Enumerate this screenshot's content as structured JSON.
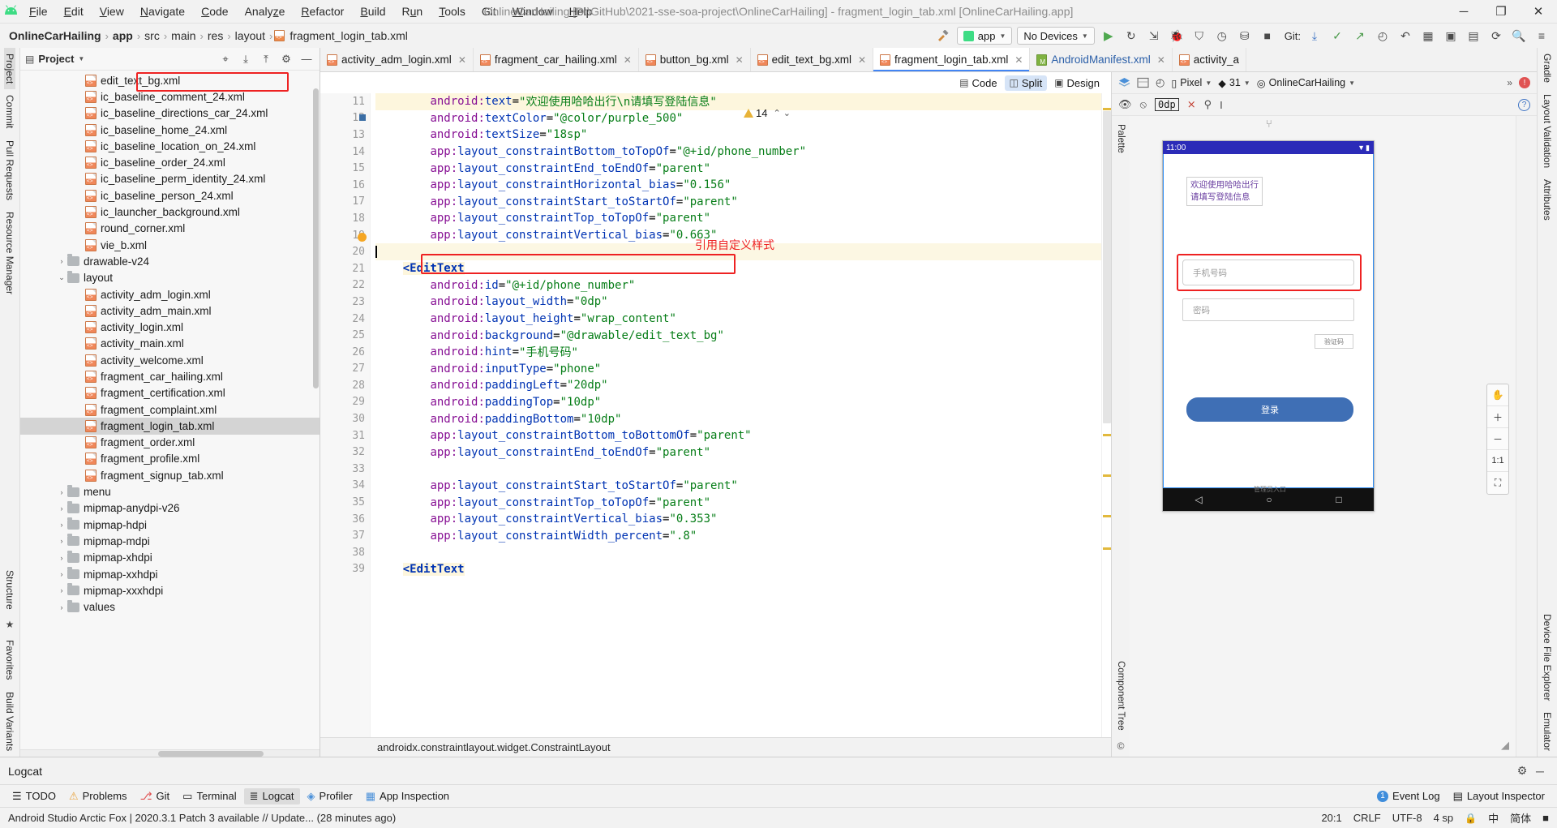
{
  "window": {
    "title": "OnlineCarHailing [D:\\GitHub\\2021-sse-soa-project\\OnlineCarHailing] - fragment_login_tab.xml [OnlineCarHailing.app]",
    "minimize": "─",
    "maximize": "❐",
    "close": "✕"
  },
  "menu": [
    {
      "label": "File"
    },
    {
      "label": "Edit"
    },
    {
      "label": "View"
    },
    {
      "label": "Navigate"
    },
    {
      "label": "Code"
    },
    {
      "label": "Analyze"
    },
    {
      "label": "Refactor"
    },
    {
      "label": "Build"
    },
    {
      "label": "Run"
    },
    {
      "label": "Tools"
    },
    {
      "label": "Git"
    },
    {
      "label": "Window"
    },
    {
      "label": "Help"
    }
  ],
  "breadcrumb": {
    "items": [
      "OnlineCarHailing",
      "app",
      "src",
      "main",
      "res",
      "layout",
      "fragment_login_tab.xml"
    ],
    "separator": "›"
  },
  "toolbar": {
    "hammer_icon": "hammer-icon",
    "app_config": "app",
    "device": "No Devices",
    "run_icon": "run-icon",
    "rerun_icon": "rerun-icon",
    "git_label": "Git:",
    "search_icon": "search-icon"
  },
  "left_rail": [
    {
      "label": "Project",
      "selected": true
    },
    {
      "label": "Commit",
      "selected": false
    },
    {
      "label": "Pull Requests",
      "selected": false
    },
    {
      "label": "Resource Manager",
      "selected": false
    },
    {
      "label": "Structure",
      "selected": false
    },
    {
      "label": "Favorites",
      "selected": false
    },
    {
      "label": "Build Variants",
      "selected": false
    }
  ],
  "right_rail": [
    {
      "label": "Gradle"
    },
    {
      "label": "Layout Validation"
    },
    {
      "label": "Attributes"
    },
    {
      "label": "Device File Explorer"
    },
    {
      "label": "Emulator"
    }
  ],
  "project_panel": {
    "title": "Project",
    "caret": "▾",
    "icons": [
      "target-icon",
      "collapse-icon",
      "expand-icon",
      "gear-icon",
      "minimize-icon"
    ],
    "tree": [
      {
        "indent": 3,
        "label": "edit_text_bg.xml",
        "type": "xml",
        "highlighted": true
      },
      {
        "indent": 3,
        "label": "ic_baseline_comment_24.xml",
        "type": "xml"
      },
      {
        "indent": 3,
        "label": "ic_baseline_directions_car_24.xml",
        "type": "xml"
      },
      {
        "indent": 3,
        "label": "ic_baseline_home_24.xml",
        "type": "xml"
      },
      {
        "indent": 3,
        "label": "ic_baseline_location_on_24.xml",
        "type": "xml"
      },
      {
        "indent": 3,
        "label": "ic_baseline_order_24.xml",
        "type": "xml"
      },
      {
        "indent": 3,
        "label": "ic_baseline_perm_identity_24.xml",
        "type": "xml"
      },
      {
        "indent": 3,
        "label": "ic_baseline_person_24.xml",
        "type": "xml"
      },
      {
        "indent": 3,
        "label": "ic_launcher_background.xml",
        "type": "xml"
      },
      {
        "indent": 3,
        "label": "round_corner.xml",
        "type": "xml"
      },
      {
        "indent": 3,
        "label": "vie_b.xml",
        "type": "xml"
      },
      {
        "indent": 2,
        "label": "drawable-v24",
        "type": "folder",
        "arrow": "›"
      },
      {
        "indent": 2,
        "label": "layout",
        "type": "folder",
        "arrow": "⌄"
      },
      {
        "indent": 3,
        "label": "activity_adm_login.xml",
        "type": "xml"
      },
      {
        "indent": 3,
        "label": "activity_adm_main.xml",
        "type": "xml"
      },
      {
        "indent": 3,
        "label": "activity_login.xml",
        "type": "xml"
      },
      {
        "indent": 3,
        "label": "activity_main.xml",
        "type": "xml"
      },
      {
        "indent": 3,
        "label": "activity_welcome.xml",
        "type": "xml"
      },
      {
        "indent": 3,
        "label": "fragment_car_hailing.xml",
        "type": "xml"
      },
      {
        "indent": 3,
        "label": "fragment_certification.xml",
        "type": "xml"
      },
      {
        "indent": 3,
        "label": "fragment_complaint.xml",
        "type": "xml"
      },
      {
        "indent": 3,
        "label": "fragment_login_tab.xml",
        "type": "xml",
        "selected": true
      },
      {
        "indent": 3,
        "label": "fragment_order.xml",
        "type": "xml"
      },
      {
        "indent": 3,
        "label": "fragment_profile.xml",
        "type": "xml"
      },
      {
        "indent": 3,
        "label": "fragment_signup_tab.xml",
        "type": "xml"
      },
      {
        "indent": 2,
        "label": "menu",
        "type": "folder",
        "arrow": "›"
      },
      {
        "indent": 2,
        "label": "mipmap-anydpi-v26",
        "type": "folder",
        "arrow": "›"
      },
      {
        "indent": 2,
        "label": "mipmap-hdpi",
        "type": "folder",
        "arrow": "›"
      },
      {
        "indent": 2,
        "label": "mipmap-mdpi",
        "type": "folder",
        "arrow": "›"
      },
      {
        "indent": 2,
        "label": "mipmap-xhdpi",
        "type": "folder",
        "arrow": "›"
      },
      {
        "indent": 2,
        "label": "mipmap-xxhdpi",
        "type": "folder",
        "arrow": "›"
      },
      {
        "indent": 2,
        "label": "mipmap-xxxhdpi",
        "type": "folder",
        "arrow": "›"
      },
      {
        "indent": 2,
        "label": "values",
        "type": "folder",
        "arrow": "›"
      }
    ]
  },
  "editor_tabs": [
    {
      "label": "activity_adm_login.xml",
      "icon": "xml",
      "active": false
    },
    {
      "label": "fragment_car_hailing.xml",
      "icon": "xml",
      "active": false
    },
    {
      "label": "button_bg.xml",
      "icon": "xml",
      "active": false
    },
    {
      "label": "edit_text_bg.xml",
      "icon": "xml",
      "active": false
    },
    {
      "label": "fragment_login_tab.xml",
      "icon": "xml",
      "active": true
    },
    {
      "label": "AndroidManifest.xml",
      "icon": "manifest",
      "active": false
    },
    {
      "label": "activity_a",
      "icon": "xml",
      "active": false
    }
  ],
  "view_modes": [
    {
      "label": "Code",
      "icon": "code-icon",
      "active": false
    },
    {
      "label": "Split",
      "icon": "split-icon",
      "active": true
    },
    {
      "label": "Design",
      "icon": "design-icon",
      "active": false
    }
  ],
  "code": {
    "warning_count": "14",
    "annotation": "引用自定义样式",
    "first_line": 11,
    "lines": [
      {
        "n": 11,
        "text": "        android:text=\"欢迎使用哈哈出行\\n请填写登陆信息\"",
        "highlight": true
      },
      {
        "n": 12,
        "text": "        android:textColor=\"@color/purple_500\""
      },
      {
        "n": 13,
        "text": "        android:textSize=\"18sp\""
      },
      {
        "n": 14,
        "text": "        app:layout_constraintBottom_toTopOf=\"@+id/phone_number\""
      },
      {
        "n": 15,
        "text": "        app:layout_constraintEnd_toEndOf=\"parent\""
      },
      {
        "n": 16,
        "text": "        app:layout_constraintHorizontal_bias=\"0.156\""
      },
      {
        "n": 17,
        "text": "        app:layout_constraintStart_toStartOf=\"parent\""
      },
      {
        "n": 18,
        "text": "        app:layout_constraintTop_toTopOf=\"parent\""
      },
      {
        "n": 19,
        "text": "        app:layout_constraintVertical_bias=\"0.663\" />"
      },
      {
        "n": 20,
        "text": "",
        "current": true
      },
      {
        "n": 21,
        "text": "    <EditText"
      },
      {
        "n": 22,
        "text": "        android:id=\"@+id/phone_number\""
      },
      {
        "n": 23,
        "text": "        android:layout_width=\"0dp\""
      },
      {
        "n": 24,
        "text": "        android:layout_height=\"wrap_content\""
      },
      {
        "n": 25,
        "text": "        android:background=\"@drawable/edit_text_bg\"",
        "boxed": true
      },
      {
        "n": 26,
        "text": "        android:hint=\"手机号码\""
      },
      {
        "n": 27,
        "text": "        android:inputType=\"phone\""
      },
      {
        "n": 28,
        "text": "        android:paddingLeft=\"20dp\""
      },
      {
        "n": 29,
        "text": "        android:paddingTop=\"10dp\""
      },
      {
        "n": 30,
        "text": "        android:paddingBottom=\"10dp\""
      },
      {
        "n": 31,
        "text": "        app:layout_constraintBottom_toBottomOf=\"parent\""
      },
      {
        "n": 32,
        "text": "        app:layout_constraintEnd_toEndOf=\"parent\""
      },
      {
        "n": 33,
        "text": ""
      },
      {
        "n": 34,
        "text": "        app:layout_constraintStart_toStartOf=\"parent\""
      },
      {
        "n": 35,
        "text": "        app:layout_constraintTop_toTopOf=\"parent\""
      },
      {
        "n": 36,
        "text": "        app:layout_constraintVertical_bias=\"0.353\""
      },
      {
        "n": 37,
        "text": "        app:layout_constraintWidth_percent=\".8\" />"
      },
      {
        "n": 38,
        "text": ""
      },
      {
        "n": 39,
        "text": "    <EditText"
      }
    ],
    "status_path": "androidx.constraintlayout.widget.ConstraintLayout"
  },
  "design": {
    "palette_label": "Palette",
    "component_tree_label": "Component Tree",
    "attributes_label": "Attributes",
    "zero_dp": "0dp",
    "device": "Pixel",
    "api": "31",
    "theme": "OnlineCarHailing",
    "help_icon": "help-icon",
    "zoom_fit": "1:1",
    "preview": {
      "status_time": "11:00",
      "welcome_text": "欢迎使用哈哈出行\n请填写登陆信息",
      "phone_hint": "手机号码",
      "password_hint": "密码",
      "code_hint": "验证码",
      "login_button": "登录",
      "admin_link": "管理员入口",
      "nav_back": "◁",
      "nav_home": "○",
      "nav_recent": "□"
    }
  },
  "logcat": {
    "title": "Logcat",
    "gear": "gear-icon",
    "minimize": "─"
  },
  "status_tabs": [
    {
      "label": "TODO",
      "icon": "list-icon"
    },
    {
      "label": "Problems",
      "icon": "warning-icon"
    },
    {
      "label": "Git",
      "icon": "git-icon"
    },
    {
      "label": "Terminal",
      "icon": "terminal-icon"
    },
    {
      "label": "Logcat",
      "icon": "logcat-icon",
      "selected": true
    },
    {
      "label": "Profiler",
      "icon": "profiler-icon"
    },
    {
      "label": "App Inspection",
      "icon": "inspection-icon"
    }
  ],
  "status_right": [
    {
      "label": "Event Log",
      "badge": "1"
    },
    {
      "label": "Layout Inspector",
      "icon": "layout-icon"
    }
  ],
  "bottom_bar": {
    "message": "Android Studio Arctic Fox | 2020.3.1 Patch 3 available // Update... (28 minutes ago)",
    "caret_pos": "20:1",
    "line_sep": "CRLF",
    "encoding": "UTF-8",
    "indent": "4",
    "indent_unit": "sp",
    "lock": "🔒",
    "ime": "中",
    "ime2": "简体",
    "tray": "■"
  }
}
